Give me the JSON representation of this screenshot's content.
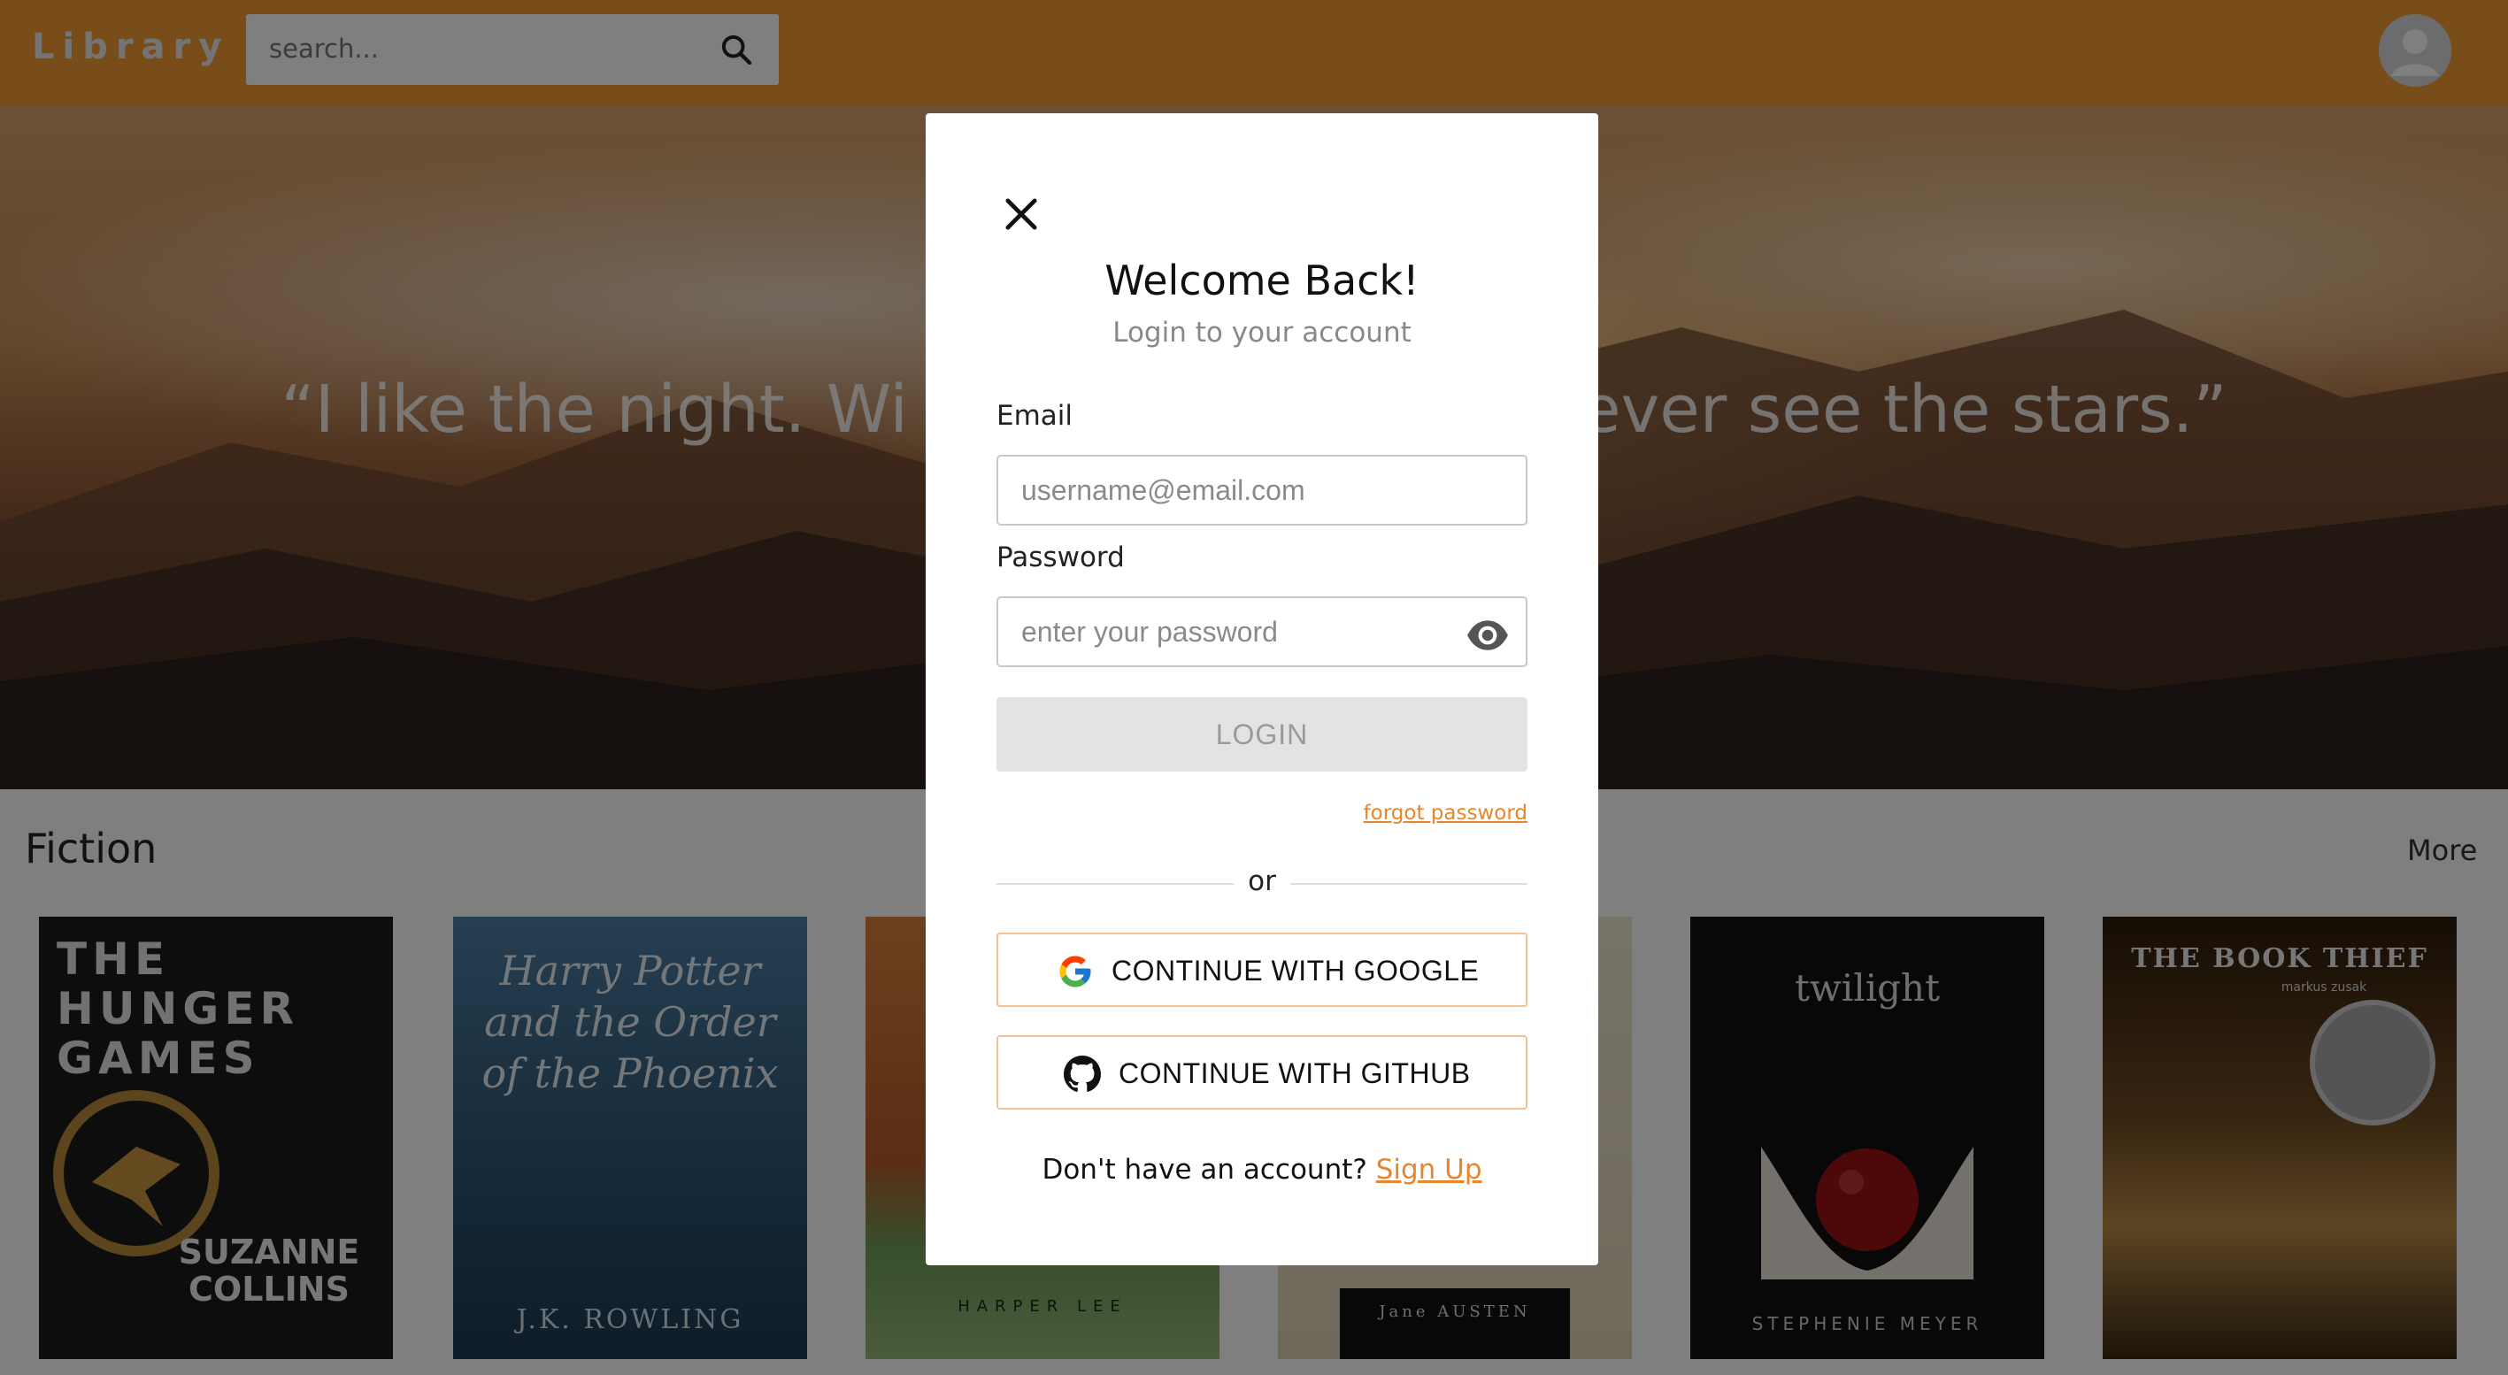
{
  "header": {
    "logo": "Library",
    "search_placeholder": "search..."
  },
  "hero": {
    "quote_left": "“I like the night. Wi",
    "quote_right": "ever see the stars.”"
  },
  "section": {
    "title": "Fiction",
    "more_label": "More"
  },
  "books": [
    {
      "title": "THE HUNGER GAMES",
      "author": "SUZANNE COLLINS"
    },
    {
      "title": "Harry Potter and the Order of the Phoenix",
      "author": "J.K. ROWLING"
    },
    {
      "title": "",
      "author": "HARPER LEE"
    },
    {
      "title": "",
      "author": "Jane AUSTEN"
    },
    {
      "title": "twilight",
      "author": "STEPHENIE MEYER"
    },
    {
      "title": "THE BOOK THIEF",
      "author": "markus zusak"
    }
  ],
  "modal": {
    "title": "Welcome Back!",
    "subtitle": "Login to your account",
    "email_label": "Email",
    "email_placeholder": "username@email.com",
    "password_label": "Password",
    "password_placeholder": "enter your password",
    "login_label": "LOGIN",
    "forgot_label": "forgot password",
    "or_label": "or",
    "google_label": "CONTINUE WITH GOOGLE",
    "github_label": "CONTINUE WITH GITHUB",
    "signup_prompt": "Don't have an account? ",
    "signup_link": "Sign Up"
  },
  "colors": {
    "brand": "#f19a34",
    "link": "#e8862c",
    "oauth_border": "#f5c193"
  },
  "icons": {
    "search": "search-icon",
    "avatar": "user-avatar-icon",
    "close": "close-icon",
    "eye": "eye-icon",
    "google": "google-logo-icon",
    "github": "github-logo-icon"
  }
}
